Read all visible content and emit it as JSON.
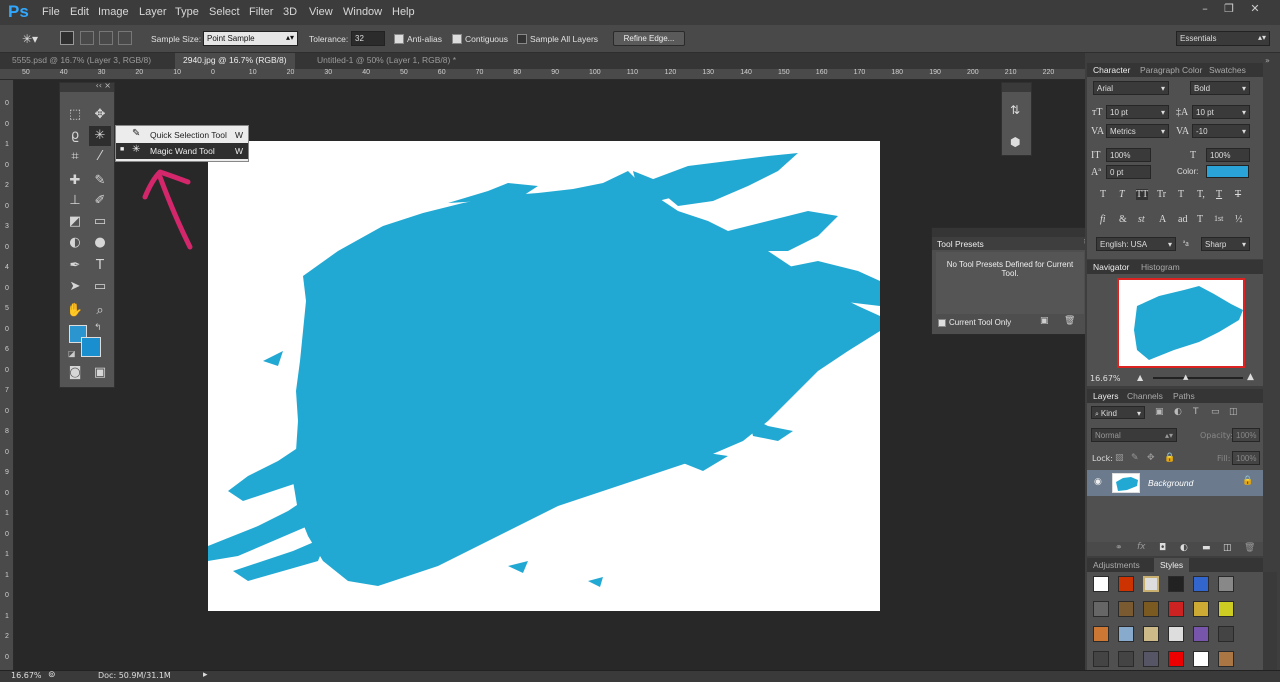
{
  "app": {
    "logo": "Ps"
  },
  "menu": [
    "File",
    "Edit",
    "Image",
    "Layer",
    "Type",
    "Select",
    "Filter",
    "3D",
    "View",
    "Window",
    "Help"
  ],
  "options": {
    "sample_size_label": "Sample Size:",
    "sample_size_value": "Point Sample",
    "tolerance_label": "Tolerance:",
    "tolerance_value": "32",
    "anti_alias": "Anti-alias",
    "contiguous": "Contiguous",
    "sample_all_layers": "Sample All Layers",
    "refine_edge": "Refine Edge...",
    "workspace": "Essentials"
  },
  "tabs": [
    {
      "label": "5555.psd @ 16.7% (Layer 3, RGB/8)",
      "active": false
    },
    {
      "label": "2940.jpg @ 16.7% (RGB/8)",
      "active": true
    },
    {
      "label": "Untitled-1 @ 50% (Layer 1, RGB/8) *",
      "active": false
    }
  ],
  "hruler": [
    "50",
    "40",
    "30",
    "20",
    "10",
    "0",
    "10",
    "20",
    "30",
    "40",
    "50",
    "60",
    "70",
    "80",
    "90",
    "100",
    "110",
    "120",
    "130",
    "140",
    "150",
    "160",
    "170",
    "180",
    "190",
    "200",
    "210",
    "220"
  ],
  "vruler": [
    "0",
    "0",
    "1",
    "0",
    "2",
    "0",
    "3",
    "0",
    "4",
    "0",
    "5",
    "0",
    "6",
    "0",
    "7",
    "0",
    "8",
    "0",
    "9",
    "0",
    "1",
    "0",
    "1",
    "1",
    "0",
    "1",
    "2",
    "0"
  ],
  "flyout": [
    {
      "label": "Quick Selection Tool",
      "key": "W"
    },
    {
      "label": "Magic Wand Tool",
      "key": "W"
    }
  ],
  "tool_presets": {
    "title": "Tool Presets",
    "message": "No Tool Presets Defined for Current Tool.",
    "current_only": "Current Tool Only"
  },
  "character": {
    "tabs": [
      "Character",
      "Paragraph",
      "Color",
      "Swatches"
    ],
    "font": "Arial",
    "style": "Bold",
    "size": "10 pt",
    "leading": "10 pt",
    "kerning": "Metrics",
    "tracking": "-10",
    "vscale": "100%",
    "hscale": "100%",
    "baseline": "0 pt",
    "color_label": "Color:",
    "color": "#2aa3d8",
    "language": "English: USA",
    "antialias": "Sharp",
    "style_glyphs": [
      "T",
      "T",
      "TT",
      "Tr",
      "T",
      "T,",
      "T",
      "T"
    ],
    "ot_glyphs": [
      "fi",
      "&",
      "st",
      "A",
      "ad",
      "T",
      "1st",
      "½"
    ]
  },
  "navigator": {
    "tabs": [
      "Navigator",
      "Histogram"
    ],
    "zoom": "16.67%"
  },
  "layers": {
    "tabs": [
      "Layers",
      "Channels",
      "Paths"
    ],
    "kind": "Kind",
    "blend": "Normal",
    "opacity_label": "Opacity:",
    "opacity": "100%",
    "lock_label": "Lock:",
    "fill_label": "Fill:",
    "fill": "100%",
    "items": [
      {
        "name": "Background"
      }
    ]
  },
  "adjust": {
    "tabs": [
      "Adjustments",
      "Styles"
    ]
  },
  "status": {
    "zoom": "16.67%",
    "doc": "Doc: 50.9M/31.1M"
  },
  "colors": {
    "paint": "#22a9d3",
    "accent": "#31a8ff",
    "arrow": "#d4276b"
  },
  "styles_swatches": [
    "#ffffff",
    "#cc3300",
    "#dddddd",
    "#222222",
    "#3366cc",
    "#888888",
    "#666666",
    "#7a5a30",
    "#7a5a20",
    "#cc2222",
    "#ccaa33",
    "#cccc22",
    "#cc7733",
    "#88aacc",
    "#ccbb88",
    "#dddddd",
    "#7755aa",
    "#444444",
    "#444444",
    "#444444",
    "#555566",
    "#ee0000",
    "#ffffff",
    "#aa7744"
  ]
}
